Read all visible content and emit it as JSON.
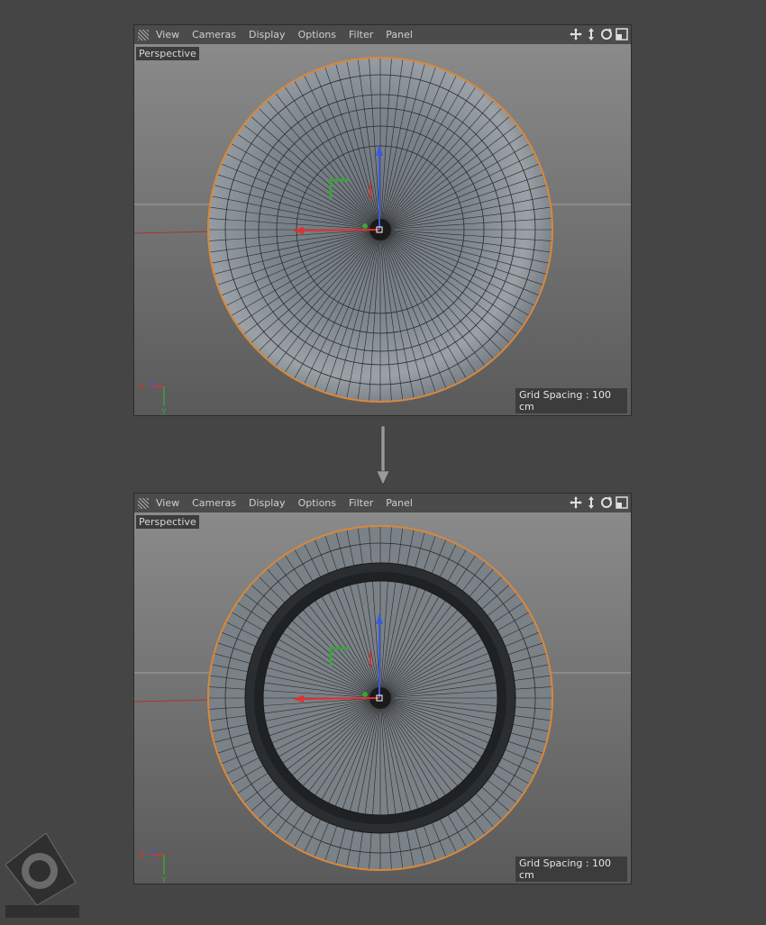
{
  "menu": {
    "view": "View",
    "cameras": "Cameras",
    "display": "Display",
    "options": "Options",
    "filter": "Filter",
    "panel": "Panel"
  },
  "viewport_top": {
    "camera": "Perspective",
    "grid_spacing": "Grid Spacing : 100 cm",
    "axis_x": "X",
    "axis_z": "Z",
    "axis_y": "Y"
  },
  "viewport_bottom": {
    "camera": "Perspective",
    "grid_spacing": "Grid Spacing : 100 cm",
    "axis_x": "X",
    "axis_z": "Z",
    "axis_y": "Y"
  },
  "nav_icons": [
    "move-icon",
    "scale-icon",
    "rotate-icon",
    "maximize-icon"
  ],
  "colors": {
    "selection_outline": "#d9883a",
    "axis_x": "#e03030",
    "axis_y": "#3aa33a",
    "axis_z": "#3a5ad9"
  }
}
